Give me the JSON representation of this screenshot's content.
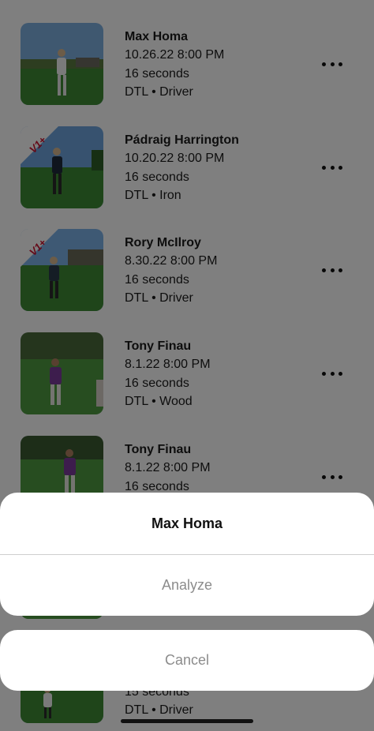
{
  "swings": [
    {
      "name": "Max Homa",
      "date": "10.26.22 8:00 PM",
      "duration": "16 seconds",
      "detail": "DTL • Driver",
      "badge": ""
    },
    {
      "name": "Pádraig Harrington",
      "date": "10.20.22 8:00 PM",
      "duration": "16 seconds",
      "detail": "DTL • Iron",
      "badge": "V1+"
    },
    {
      "name": "Rory McIlroy",
      "date": "8.30.22 8:00 PM",
      "duration": "16 seconds",
      "detail": "DTL • Driver",
      "badge": "V1+"
    },
    {
      "name": "Tony Finau",
      "date": "8.1.22 8:00 PM",
      "duration": "16 seconds",
      "detail": "DTL • Wood",
      "badge": ""
    },
    {
      "name": "Tony Finau",
      "date": "8.1.22 8:00 PM",
      "duration": "16 seconds",
      "detail": "",
      "badge": ""
    },
    {
      "name": "",
      "date": "",
      "duration": "15 seconds",
      "detail": "DTL • Driver",
      "badge": ""
    }
  ],
  "action_sheet": {
    "title": "Max Homa",
    "analyze_label": "Analyze",
    "cancel_label": "Cancel"
  },
  "icons": {
    "row_menu": "more-horizontal-icon"
  },
  "colors": {
    "scrim": "#000000",
    "sheet_background": "#ffffff",
    "disabled_text": "#8c8c8c"
  }
}
